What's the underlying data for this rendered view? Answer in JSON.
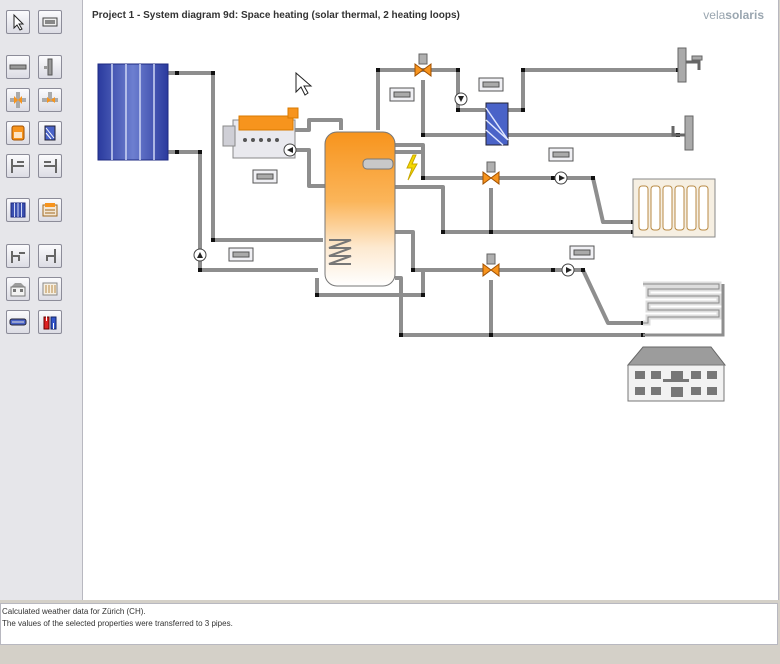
{
  "header": {
    "title": "Project 1 - System diagram 9d: Space heating (solar thermal, 2 heating loops)",
    "brand_regular": "vela",
    "brand_bold": "solaris"
  },
  "toolbar": {
    "tools": [
      {
        "name": "select-pointer-icon"
      },
      {
        "name": "parameter-display-icon"
      },
      {
        "name": "horizontal-pipe-icon"
      },
      {
        "name": "vertical-pipe-icon"
      },
      {
        "name": "three-way-valve-icon"
      },
      {
        "name": "diverter-valve-icon"
      },
      {
        "name": "boiler-icon"
      },
      {
        "name": "heat-exchanger-icon"
      },
      {
        "name": "pipe-junction-left-icon"
      },
      {
        "name": "pipe-junction-right-icon"
      },
      {
        "name": "solar-collector-icon"
      },
      {
        "name": "auxiliary-heater-icon"
      },
      {
        "name": "tap-left-icon"
      },
      {
        "name": "tap-right-icon"
      },
      {
        "name": "building-icon"
      },
      {
        "name": "radiator-icon"
      },
      {
        "name": "floor-heating-icon"
      },
      {
        "name": "heat-load-icon"
      }
    ]
  },
  "colors": {
    "canvas_bg": "#ffffff",
    "tank_orange": "#f7941d",
    "collector_blue": "#3a4fb0",
    "pipe_grey": "#8e8e8e",
    "lightning_yellow": "#f5d800"
  },
  "status": {
    "line1": "Calculated weather data for Zürich (CH).",
    "line2": "The values of the selected properties were transferred to 3 pipes."
  }
}
